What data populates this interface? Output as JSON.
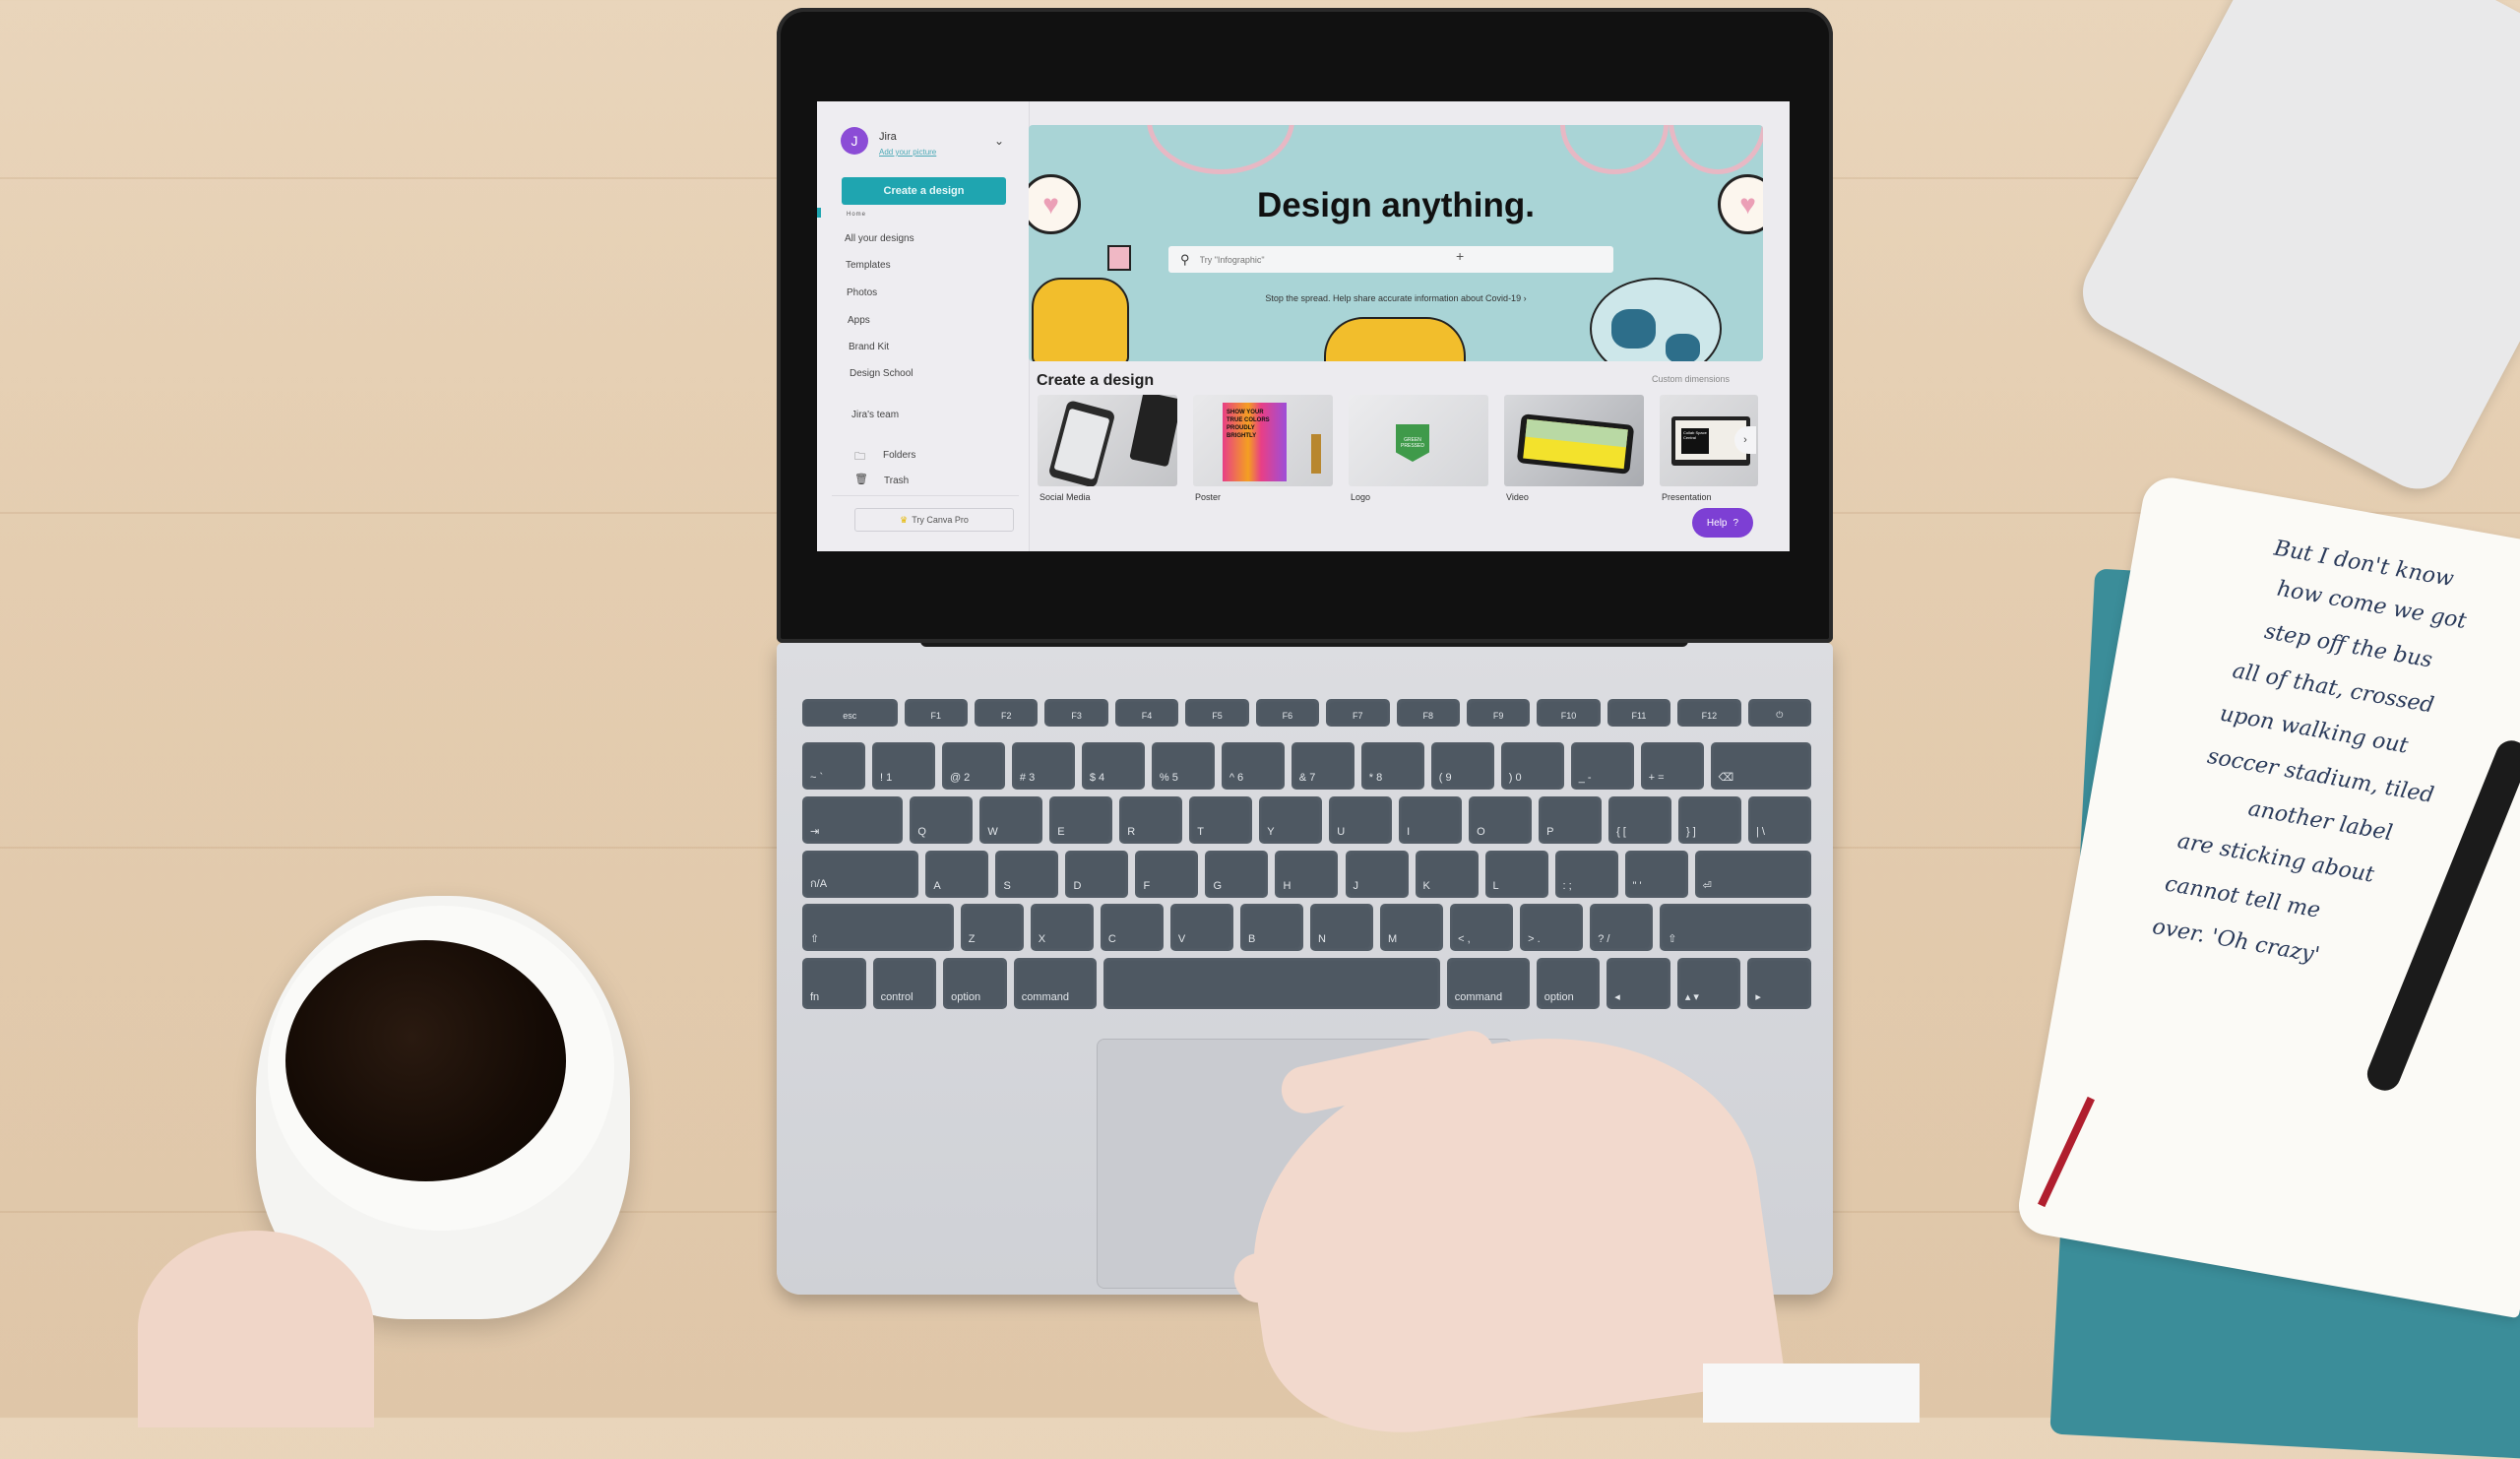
{
  "canva": {
    "account": {
      "initial": "J",
      "name": "Jira",
      "add_picture_link": "Add your picture"
    },
    "sidebar": {
      "create_button": "Create a design",
      "home_label": "Home",
      "items": [
        {
          "label": "All your designs"
        },
        {
          "label": "Templates"
        },
        {
          "label": "Photos"
        },
        {
          "label": "Apps"
        },
        {
          "label": "Brand Kit"
        },
        {
          "label": "Design School"
        }
      ],
      "team_label": "Jira's team",
      "folders_label": "Folders",
      "trash_label": "Trash",
      "pro_button": "Try Canva Pro",
      "icons": {
        "folder": "🗀",
        "trash": "🗑",
        "crown": "♛",
        "chevron": "⌄"
      }
    },
    "hero": {
      "title": "Design anything.",
      "search_placeholder": "Try \"Infographic\"",
      "search_icon": "⚲",
      "covid_link": "Stop the spread. Help share accurate information about Covid-19 ›"
    },
    "create_section": {
      "title": "Create a design",
      "custom_dimensions": "Custom dimensions",
      "cards": [
        {
          "label": "Social Media",
          "color": "#c9cacd"
        },
        {
          "label": "Poster",
          "color": "#e83f86",
          "poster_text": "SHOW YOUR TRUE COLORS PROUDLY BRIGHTLY"
        },
        {
          "label": "Logo",
          "color": "#dfe0e2",
          "logo_text": "GREEN PRESSED"
        },
        {
          "label": "Video",
          "color": "#f3e22c"
        },
        {
          "label": "Presentation",
          "color": "#cfcfd2",
          "slide_text": "Collab Space Central"
        }
      ],
      "next_arrow": "›"
    },
    "help_button": {
      "label": "Help",
      "icon": "?"
    },
    "colors": {
      "accent_teal": "#1fa5b0",
      "help_purple": "#7d3fd4",
      "avatar_purple": "#8b4cd6",
      "hero_bg": "#a9d4d6"
    }
  },
  "keyboard": {
    "rows": [
      [
        "esc",
        "F1",
        "F2",
        "F3",
        "F4",
        "F5",
        "F6",
        "F7",
        "F8",
        "F9",
        "F10",
        "F11",
        "F12",
        "⏻"
      ],
      [
        "~ `",
        "! 1",
        "@ 2",
        "# 3",
        "$ 4",
        "% 5",
        "^ 6",
        "& 7",
        "* 8",
        "( 9",
        ") 0",
        "_ -",
        "+ =",
        "⌫"
      ],
      [
        "⇥",
        "Q",
        "W",
        "E",
        "R",
        "T",
        "Y",
        "U",
        "I",
        "O",
        "P",
        "{ [",
        "} ]",
        "| \\"
      ],
      [
        "ก/A",
        "A",
        "S",
        "D",
        "F",
        "G",
        "H",
        "J",
        "K",
        "L",
        ": ;",
        "\" '",
        "⏎"
      ],
      [
        "⇧",
        "Z",
        "X",
        "C",
        "V",
        "B",
        "N",
        "M",
        "< ,",
        "> .",
        "? /",
        "⇧"
      ],
      [
        "fn",
        "control",
        "option",
        "command",
        "",
        "command",
        "option",
        "◂",
        "▴ ▾",
        "▸"
      ]
    ]
  },
  "handwriting": [
    "But I don't know",
    "how come we got",
    "step off the bus",
    "all of that, crossed",
    "upon walking out",
    "soccer stadium, tiled",
    "another label",
    "are sticking about",
    "cannot tell me",
    "over. 'Oh crazy'"
  ]
}
